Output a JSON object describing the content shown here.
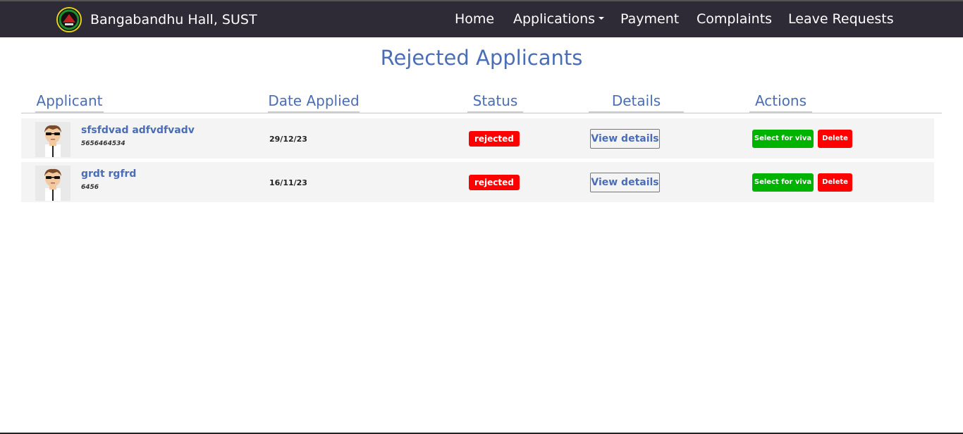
{
  "navbar": {
    "brand": "Bangabandhu Hall, SUST",
    "items": [
      "Home",
      "Applications",
      "Payment",
      "Complaints",
      "Leave Requests"
    ]
  },
  "page": {
    "title": "Rejected Applicants"
  },
  "table": {
    "headers": [
      "Applicant",
      "Date Applied",
      "Status",
      "Details",
      "Actions"
    ],
    "rows": [
      {
        "name": "sfsfdvad adfvdfvadv",
        "reg": "5656464534",
        "date": "29/12/23",
        "status": "rejected",
        "details": "View details",
        "viva": "Select for viva",
        "delete": "Delete"
      },
      {
        "name": "grdt rgfrd",
        "reg": "6456",
        "date": "16/11/23",
        "status": "rejected",
        "details": "View details",
        "viva": "Select for viva",
        "delete": "Delete"
      }
    ]
  },
  "colors": {
    "navbar": "#2e2a36",
    "accent": "#4a6db5",
    "danger": "#ff0000",
    "success": "#00b300"
  }
}
